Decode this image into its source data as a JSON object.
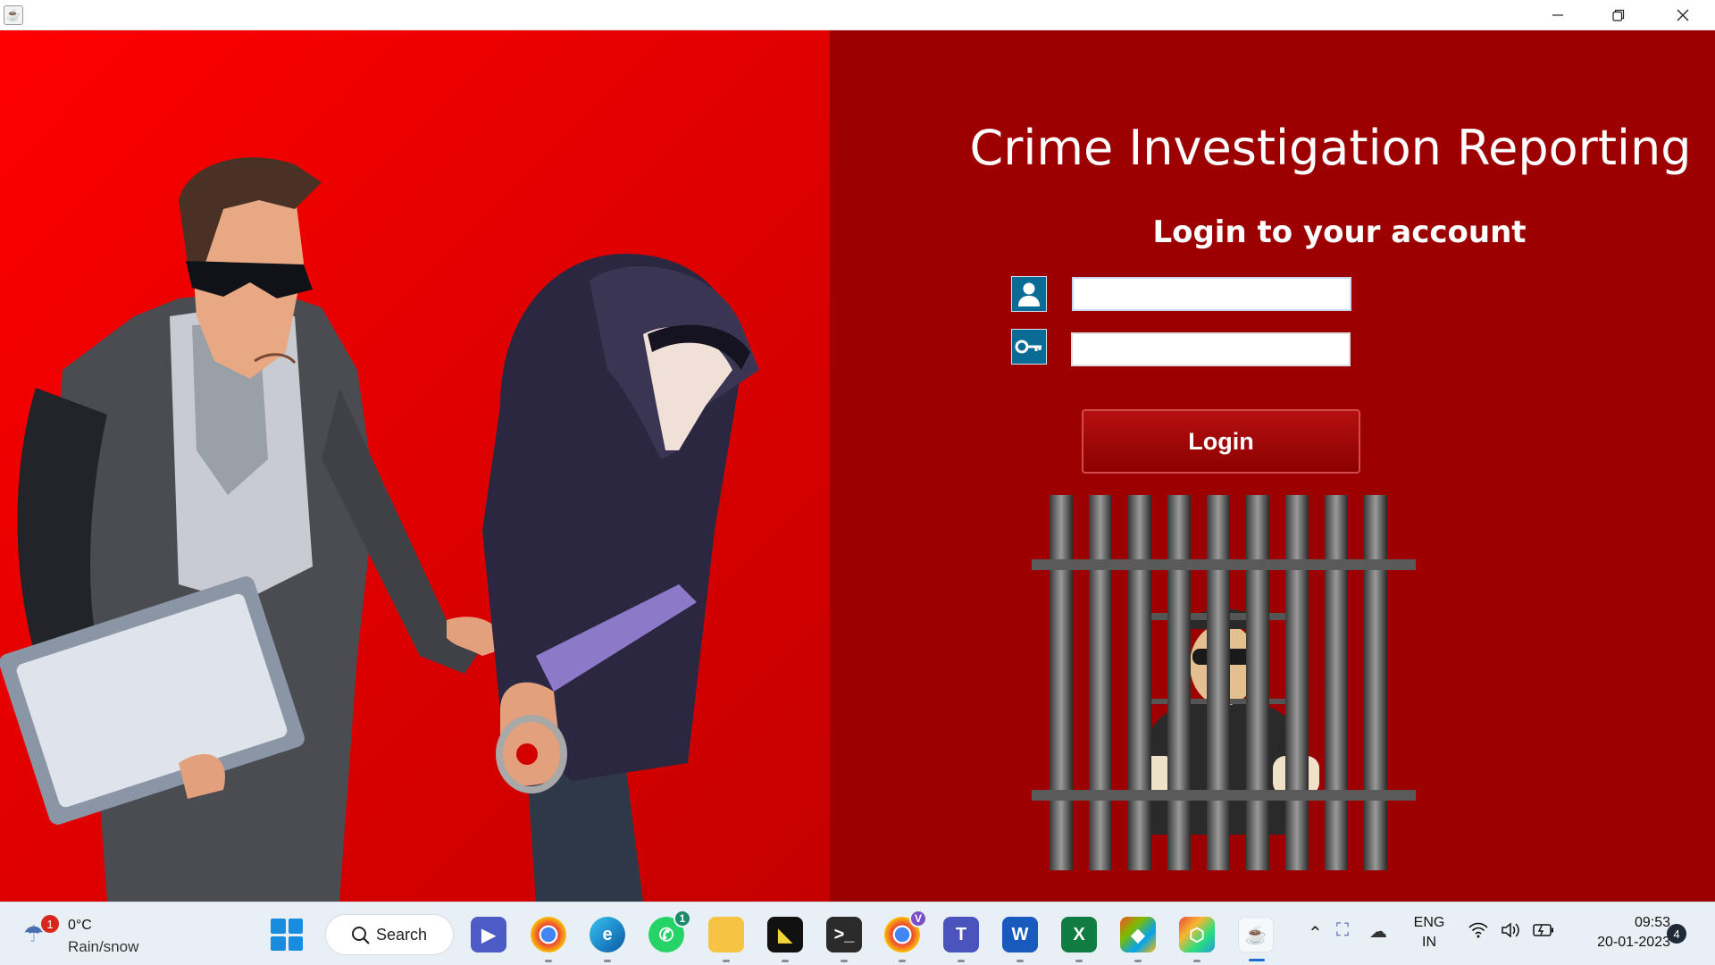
{
  "window": {
    "app_icon": "java-icon",
    "controls": {
      "minimize_icon": "minimize-icon",
      "maximize_icon": "restore-icon",
      "close_icon": "close-icon"
    }
  },
  "colors": {
    "left_panel": "#ff0000",
    "right_panel": "#9d0000",
    "login_button": "#a00808",
    "field_icon_bg": "#0a6c96"
  },
  "login": {
    "title": "Crime Investigation Reporting",
    "subtitle": "Login to your account",
    "username_icon": "user-icon",
    "password_icon": "key-icon",
    "username_value": "",
    "password_value": "",
    "button_label": "Login"
  },
  "illustrations": {
    "left": "detective-arresting-hooded-criminal",
    "right": "prisoner-behind-bars"
  },
  "taskbar": {
    "weather": {
      "badge": "1",
      "temperature": "0°C",
      "condition": "Rain/snow",
      "icon": "umbrella-icon"
    },
    "search_label": "Search",
    "apps": [
      {
        "name": "meet-icon",
        "badge": ""
      },
      {
        "name": "chrome-icon",
        "badge": ""
      },
      {
        "name": "edge-icon",
        "badge": ""
      },
      {
        "name": "whatsapp-icon",
        "badge": "1"
      },
      {
        "name": "file-explorer-icon",
        "badge": ""
      },
      {
        "name": "sticky-notes-icon",
        "badge": ""
      },
      {
        "name": "terminal-icon",
        "badge": ""
      },
      {
        "name": "chrome-profile-icon",
        "badge": "V"
      },
      {
        "name": "teams-icon",
        "badge": ""
      },
      {
        "name": "word-icon",
        "badge": ""
      },
      {
        "name": "excel-icon",
        "badge": ""
      },
      {
        "name": "git-icon",
        "badge": ""
      },
      {
        "name": "dev-tool-icon",
        "badge": ""
      },
      {
        "name": "java-app-icon",
        "badge": ""
      }
    ],
    "tray": {
      "language": "ENG",
      "region": "IN",
      "time": "09:53",
      "date": "20-01-2023",
      "notification_count": "4"
    }
  }
}
